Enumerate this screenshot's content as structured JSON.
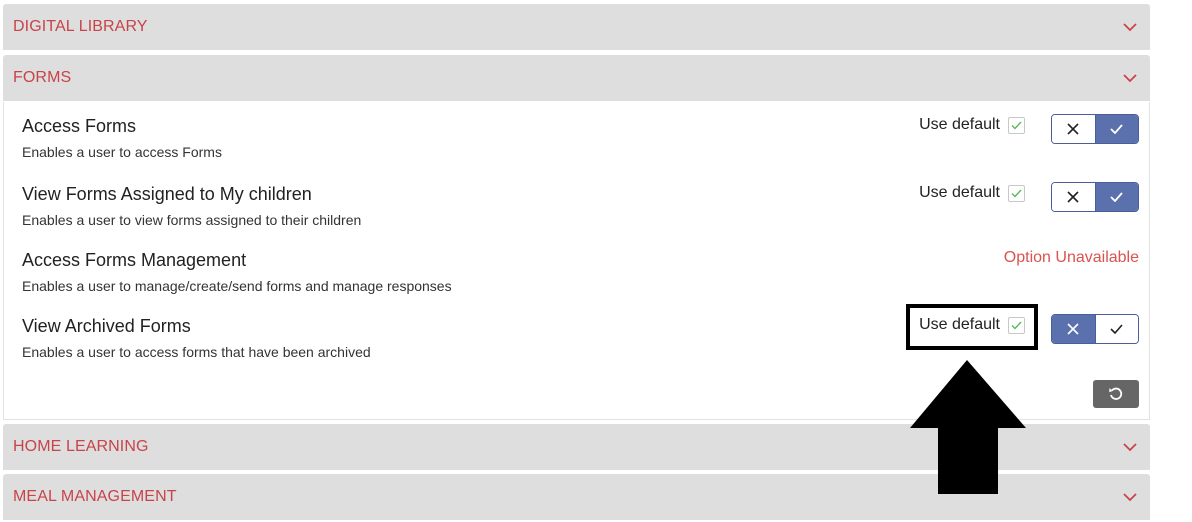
{
  "sections": {
    "digital_library": {
      "title": "DIGITAL LIBRARY"
    },
    "forms": {
      "title": "FORMS"
    },
    "home_learning": {
      "title": "HOME LEARNING"
    },
    "meal_management": {
      "title": "MEAL MANAGEMENT"
    }
  },
  "forms_permissions": [
    {
      "title": "Access Forms",
      "description": "Enables a user to access Forms",
      "use_default_label": "Use default",
      "use_default_checked": true,
      "state": "allow"
    },
    {
      "title": "View Forms Assigned to My children",
      "description": "Enables a user to view forms assigned to their children",
      "use_default_label": "Use default",
      "use_default_checked": true,
      "state": "allow"
    },
    {
      "title": "Access Forms Management",
      "description": "Enables a user to manage/create/send forms and manage responses",
      "unavailable_text": "Option Unavailable"
    },
    {
      "title": "View Archived Forms",
      "description": "Enables a user to access forms that have been archived",
      "use_default_label": "Use default",
      "use_default_checked": true,
      "state": "deny"
    }
  ],
  "colors": {
    "section_title": "#c8434a",
    "header_bg": "#dedede",
    "toggle_active": "#5b71ad",
    "unavailable": "#d9534f",
    "check_green": "#5cb85c",
    "reset_button": "#666666"
  },
  "icons": {
    "chevron": "chevron-down-icon",
    "deny": "x-icon",
    "allow": "check-icon",
    "reset": "reset-icon",
    "annotation_arrow": "up-arrow-icon"
  }
}
